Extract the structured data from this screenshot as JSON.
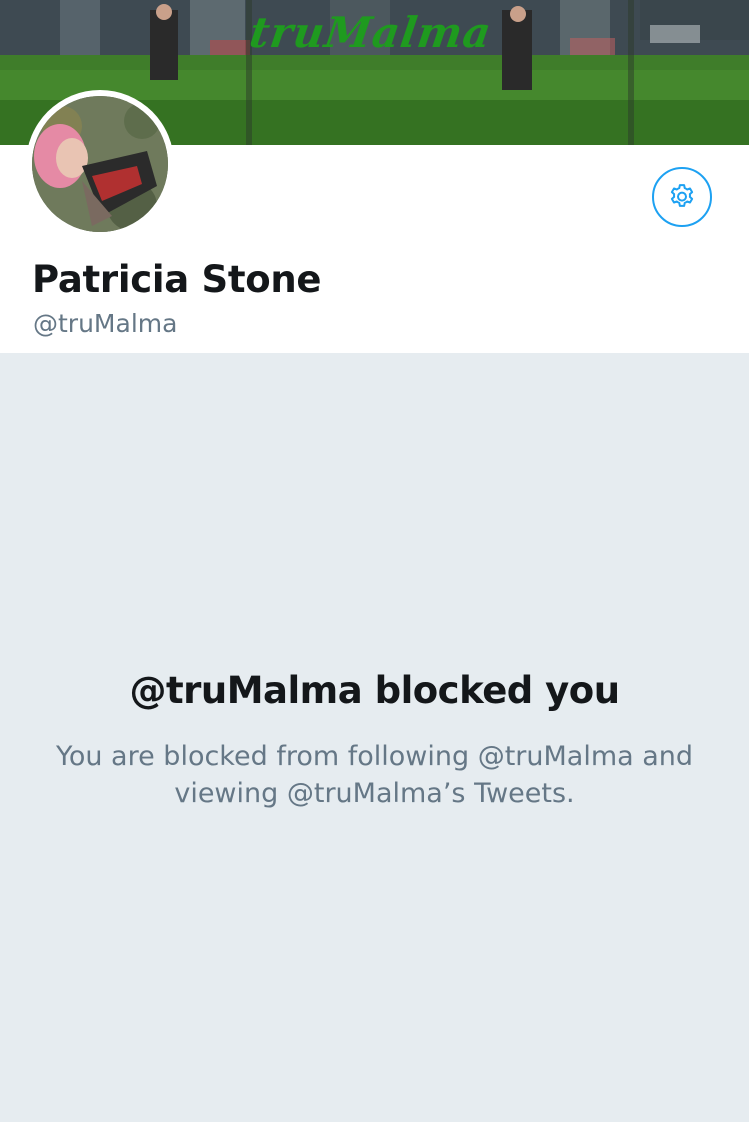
{
  "banner": {
    "logo_text": "truMalma",
    "logo_color": "#1f9a1f"
  },
  "profile": {
    "display_name": "Patricia Stone",
    "handle": "@truMalma",
    "settings_icon": "gear-icon"
  },
  "blocked": {
    "title": "@truMalma blocked you",
    "description": "You are blocked from following @truMalma and viewing @truMalma’s Tweets."
  },
  "colors": {
    "accent": "#1da1f2",
    "background": "#e6ecf0",
    "primary_text": "#14171a",
    "secondary_text": "#657786"
  }
}
